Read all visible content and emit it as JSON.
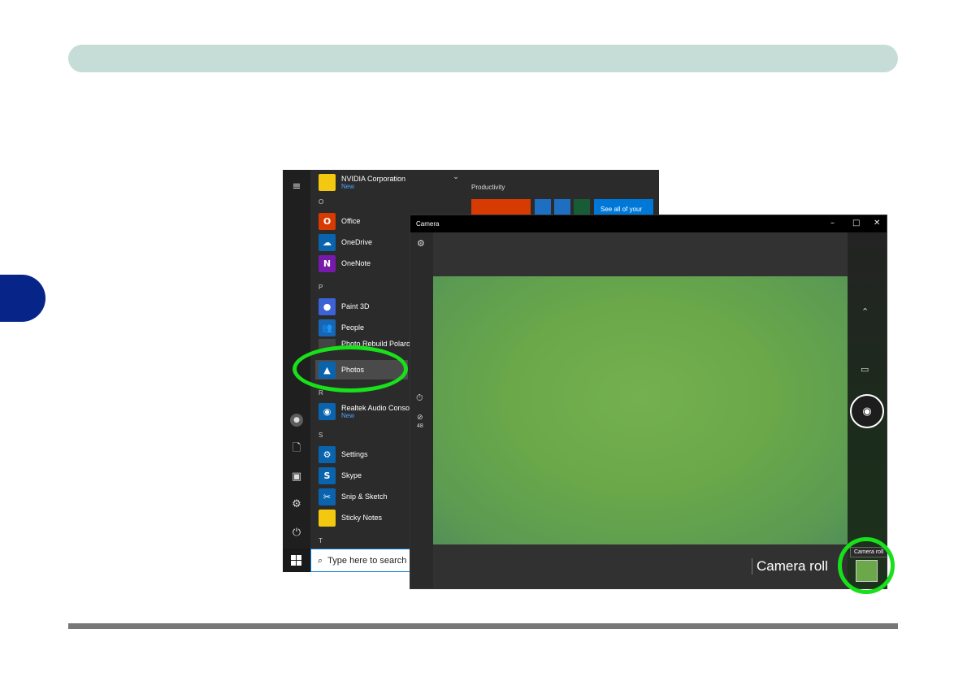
{
  "start_menu": {
    "apps_top": {
      "name": "NVIDIA Corporation",
      "sub": "New"
    },
    "letters": [
      "O",
      "P",
      "R",
      "S",
      "T"
    ],
    "apps": [
      {
        "name": "Office",
        "sub": "",
        "color": "#d83b01",
        "glyph": "O"
      },
      {
        "name": "OneDrive",
        "sub": "",
        "color": "#0a64ad",
        "glyph": "☁"
      },
      {
        "name": "OneNote",
        "sub": "",
        "color": "#7719aa",
        "glyph": "N"
      },
      {
        "name": "Paint 3D",
        "sub": "",
        "color": "#3c63d6",
        "glyph": "●"
      },
      {
        "name": "People",
        "sub": "",
        "color": "#1766b3",
        "glyph": "👥"
      },
      {
        "name": "Photos",
        "sub": "",
        "color": "#0a64ad",
        "glyph": "▲"
      },
      {
        "name": "Realtek Audio Console",
        "sub": "New",
        "color": "#0a64ad",
        "glyph": "◉"
      },
      {
        "name": "Settings",
        "sub": "",
        "color": "#0a64ad",
        "glyph": "⚙"
      },
      {
        "name": "Skype",
        "sub": "",
        "color": "#0a64ad",
        "glyph": "S"
      },
      {
        "name": "Snip & Sketch",
        "sub": "",
        "color": "#0a64ad",
        "glyph": "✂"
      },
      {
        "name": "Sticky Notes",
        "sub": "",
        "color": "#f2c811",
        "glyph": ""
      }
    ],
    "partial_app": "Photo Rebuild Polaroid",
    "productivity_label": "Productivity",
    "see_all": "See all of your",
    "search_placeholder": "Type here to search"
  },
  "camera": {
    "title": "Camera",
    "resolution": "48",
    "camera_roll_label": "Camera roll",
    "tooltip": "Camera roll"
  }
}
